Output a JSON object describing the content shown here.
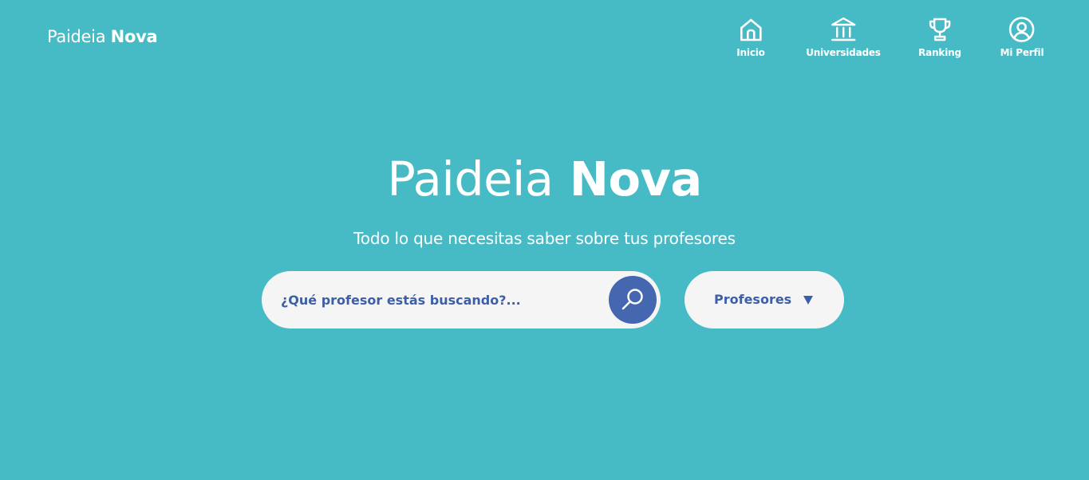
{
  "brand": {
    "name_light": "Paideia",
    "name_bold": "Nova"
  },
  "nav": {
    "items": [
      {
        "label": "Inicio",
        "icon": "home-icon"
      },
      {
        "label": "Universidades",
        "icon": "university-icon"
      },
      {
        "label": "Ranking",
        "icon": "trophy-icon"
      },
      {
        "label": "Mi Perfil",
        "icon": "user-circle-icon"
      }
    ]
  },
  "hero": {
    "title_light": "Paideia",
    "title_bold": "Nova",
    "subtitle": "Todo lo que necesitas saber sobre tus profesores"
  },
  "search": {
    "placeholder": "¿Qué profesor estás buscando?...",
    "value": "",
    "icon": "search-icon"
  },
  "category": {
    "selected": "Profesores",
    "icon": "triangle-down-icon"
  },
  "colors": {
    "background": "#47BBC5",
    "accent": "#4467B0",
    "text_dark": "#3D5FA8",
    "field_bg": "#F5F5F5"
  }
}
